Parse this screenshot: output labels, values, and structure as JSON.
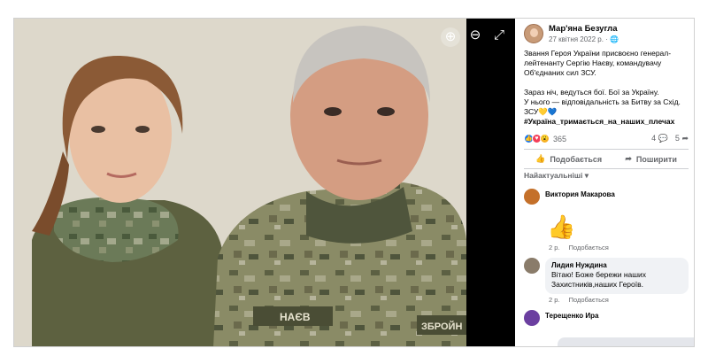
{
  "viewer": {
    "zoom_in_icon": "zoom-in-icon",
    "zoom_out_icon": "zoom-out-icon",
    "fullscreen_icon": "fullscreen-icon",
    "photo_patch_text": "НАЄВ",
    "photo_patch_text2": "ЗБРОЙН"
  },
  "post": {
    "author": "Мар'яна Безугла",
    "date": "27 квітня 2022 р.",
    "visibility_icon": "globe-icon",
    "paragraph1": "Звання Героя України присвоєно генерал-лейтенанту Сергію Наєву, командувачу Об'єднаних сил ЗСУ.",
    "paragraph2_line1": "Зараз ніч, ведуться бої. Бої за Україну.",
    "paragraph2_line2": "У нього — відповідальність за Битву за Схід.",
    "paragraph2_line3": "ЗСУ💛💙",
    "hashtag": "#Україна_тримається_на_наших_плечах"
  },
  "stats": {
    "reactions": "365",
    "comments": "4",
    "shares": "5"
  },
  "actions": {
    "like_label": "Подобається",
    "share_label": "Поширити"
  },
  "sort_label": "Найактуальніші",
  "comments": [
    {
      "name": "Виктория Макарова",
      "time": "2 р.",
      "like": "Подобається"
    },
    {
      "name": "Лидия Нуждина",
      "text": "Вітаю! Боже бережи наших Захистників,наших Героїв.",
      "time": "2 р.",
      "like": "Подобається"
    },
    {
      "name": "Терещенко Ира"
    }
  ],
  "colors": {
    "accent": "#1877f2",
    "text": "#050505",
    "secondary": "#65676b",
    "viewer_bg": "#000000"
  }
}
